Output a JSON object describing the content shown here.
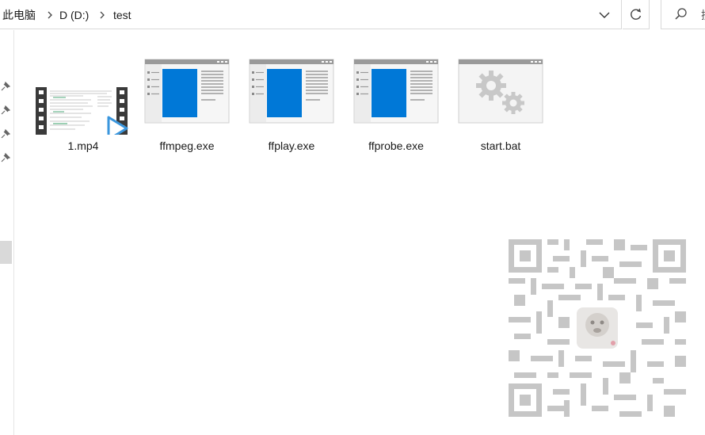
{
  "breadcrumb": {
    "items": [
      "此电脑",
      "D (D:)",
      "test"
    ]
  },
  "search": {
    "placeholder_fragment": "搜"
  },
  "files": [
    {
      "name": "1.mp4",
      "icon": "video-thumbnail-icon"
    },
    {
      "name": "ffmpeg.exe",
      "icon": "exe-window-icon"
    },
    {
      "name": "ffplay.exe",
      "icon": "exe-window-icon"
    },
    {
      "name": "ffprobe.exe",
      "icon": "exe-window-icon"
    },
    {
      "name": "start.bat",
      "icon": "batch-gears-icon"
    }
  ],
  "colors": {
    "accent_blue": "#0078d7",
    "play_blue": "#3a96dd",
    "gear_gray": "#c8c8c8",
    "qr_gray": "#c6c6c6"
  }
}
